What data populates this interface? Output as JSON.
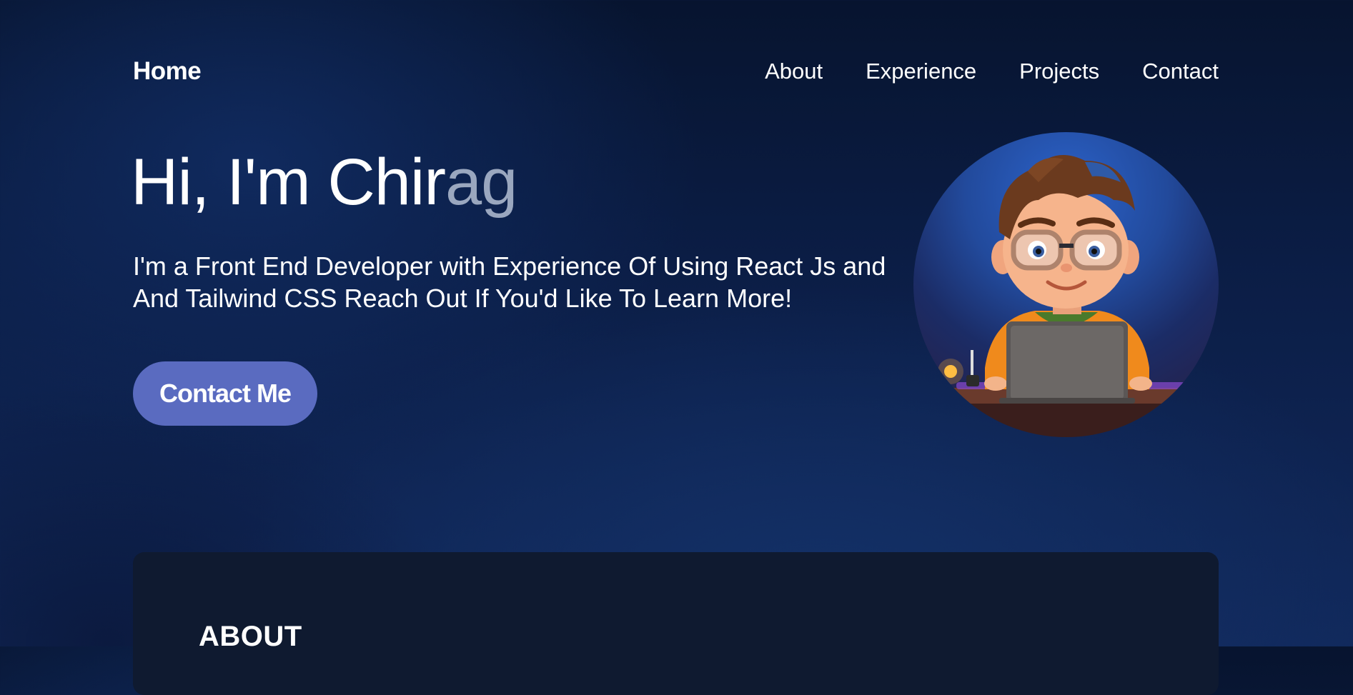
{
  "nav": {
    "home": "Home",
    "links": [
      "About",
      "Experience",
      "Projects",
      "Contact"
    ]
  },
  "hero": {
    "greeting_main": "Hi, I'm Chir",
    "greeting_faded": "ag",
    "description_line1": "I'm a Front End Developer with Experience Of Using React Js and",
    "description_line2": "And Tailwind CSS Reach Out If You'd Like To Learn More!",
    "cta_label": "Contact Me",
    "avatar_icon": "developer-avatar-illustration"
  },
  "about": {
    "title": "ABOUT"
  },
  "colors": {
    "background": "#0b1d45",
    "cta_button": "#5a6bc0",
    "about_card": "#0f1a30",
    "faded_text": "#9aa7bf"
  }
}
